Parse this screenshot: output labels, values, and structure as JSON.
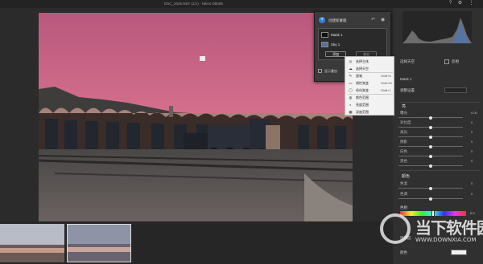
{
  "window": {
    "filename": "DSC_2026.NEF (1/1) - Nikon D800E"
  },
  "masks_panel": {
    "title": "创建新蒙版",
    "mask_name": "Mask 1",
    "sub_mask": "Sky 1",
    "add_button": "添加",
    "subtract_button": "减去",
    "show_overlay": "显示叠加"
  },
  "add_menu": {
    "items": [
      {
        "icon": "subject-icon",
        "label": "选择主体",
        "shortcut": ""
      },
      {
        "icon": "sky-icon",
        "label": "选择天空",
        "shortcut": ""
      },
      {
        "icon": "brush-icon",
        "label": "画笔",
        "shortcut": "Shift+K"
      },
      {
        "icon": "linear-gradient-icon",
        "label": "线性渐变",
        "shortcut": "Shift+M"
      },
      {
        "icon": "radial-gradient-icon",
        "label": "径向渐变",
        "shortcut": "Shift+J"
      },
      {
        "icon": "color-range-icon",
        "label": "颜色范围",
        "shortcut": ""
      },
      {
        "icon": "luminance-range-icon",
        "label": "亮度范围",
        "shortcut": ""
      },
      {
        "icon": "depth-range-icon",
        "label": "深度范围",
        "shortcut": ""
      }
    ]
  },
  "right_panel": {
    "select_sky": "选择天空",
    "invert": "反相",
    "mask_label": "Mask 1",
    "amount_label": "调整设置",
    "light_section": "亮",
    "sliders_light": [
      {
        "label": "曝光",
        "value": "0.00",
        "pos": 0.5
      },
      {
        "label": "对比度",
        "value": "0",
        "pos": 0.5
      },
      {
        "label": "高光",
        "value": "0",
        "pos": 0.5
      },
      {
        "label": "阴影",
        "value": "0",
        "pos": 0.5
      },
      {
        "label": "白色",
        "value": "0",
        "pos": 0.5
      },
      {
        "label": "黑色",
        "value": "0",
        "pos": 0.5
      }
    ],
    "color_section": "颜色",
    "sliders_color": [
      {
        "label": "色温",
        "value": "0",
        "pos": 0.5
      },
      {
        "label": "色调",
        "value": "0",
        "pos": 0.5
      }
    ],
    "hue_label": "色相",
    "hue_value": "0.0",
    "saturation_label": "饱和度",
    "color_label": "颜色"
  },
  "watermark": {
    "text": "当下软件园",
    "url": "WWW.DOWNXIA.COM"
  },
  "colors": {
    "sky_top": "#c55f82",
    "sky_mid": "#d86f8f",
    "accent": "#2f7fd7"
  }
}
